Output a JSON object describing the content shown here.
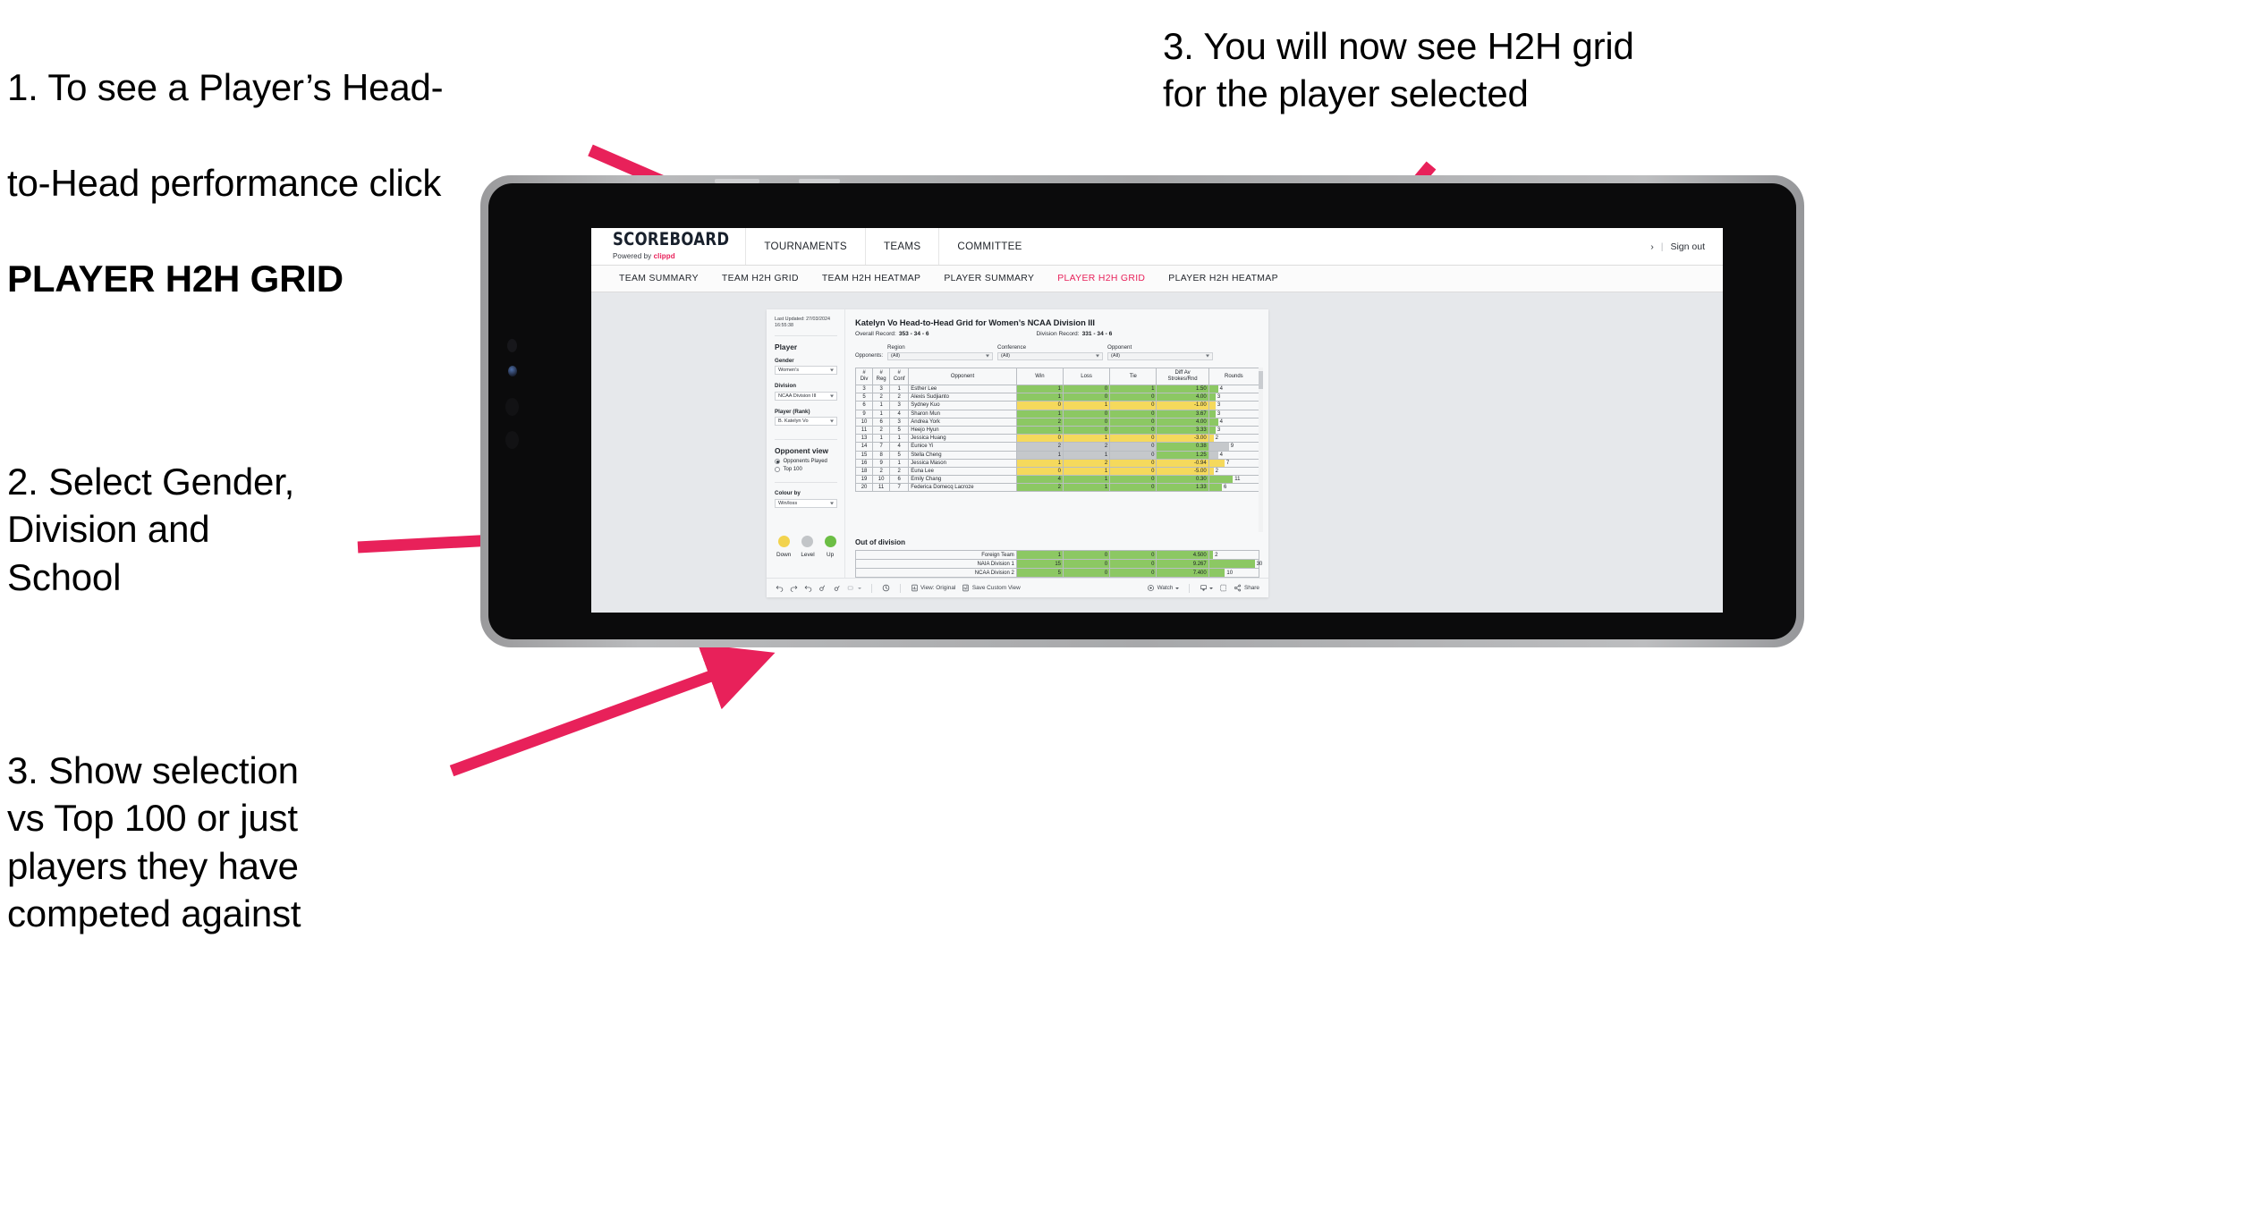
{
  "annotations": [
    {
      "id": "callout-1",
      "line1": "1. To see a Player’s Head-",
      "line2": "to-Head performance click",
      "line3": "PLAYER H2H GRID"
    },
    {
      "id": "callout-2",
      "text": "2. Select Gender,\nDivision and\nSchool"
    },
    {
      "id": "callout-3",
      "text": "3. Show selection\nvs Top 100 or just\nplayers they have\ncompeted against"
    },
    {
      "id": "callout-4",
      "text": "3. You will now see H2H grid\nfor the player selected"
    }
  ],
  "accent_pink": "#E8215A",
  "colors": {
    "up_green": "#8CC863",
    "level_grey": "#C5C8CB",
    "down_yellow": "#F5D95C"
  },
  "browser": {
    "brand": {
      "title": "SCOREBOARD",
      "sub_prefix": "Powered by ",
      "sub_brand": "clippd"
    },
    "topnav": [
      "TOURNAMENTS",
      "TEAMS",
      "COMMITTEE"
    ],
    "account": {
      "chevron": "›",
      "separator": "|",
      "signout": "Sign out"
    },
    "subnav": [
      {
        "label": "TEAM SUMMARY",
        "active": false
      },
      {
        "label": "TEAM H2H GRID",
        "active": false
      },
      {
        "label": "TEAM H2H HEATMAP",
        "active": false
      },
      {
        "label": "PLAYER SUMMARY",
        "active": false
      },
      {
        "label": "PLAYER H2H GRID",
        "active": true
      },
      {
        "label": "PLAYER H2H HEATMAP",
        "active": false
      }
    ]
  },
  "sidebar": {
    "last_updated": "Last Updated: 27/03/2024 16:55:38",
    "player_heading": "Player",
    "fields": [
      {
        "label": "Gender",
        "value": "Women's"
      },
      {
        "label": "Division",
        "value": "NCAA Division III"
      },
      {
        "label": "Player (Rank)",
        "value": "B. Katelyn Vo"
      }
    ],
    "opponent_view": {
      "heading": "Opponent view",
      "options": [
        {
          "label": "Opponents Played",
          "selected": true
        },
        {
          "label": "Top 100",
          "selected": false
        }
      ]
    },
    "colour_by": {
      "label": "Colour by",
      "value": "Win/loss"
    },
    "legend": [
      {
        "caption": "Down",
        "color": "#F2D34E"
      },
      {
        "caption": "Level",
        "color": "#C2C5C8"
      },
      {
        "caption": "Up",
        "color": "#6CBE45"
      }
    ]
  },
  "viz": {
    "title": "Katelyn Vo Head-to-Head Grid for Women’s NCAA Division III",
    "overall_label": "Overall Record:",
    "overall_value": "353 -  34 - 6",
    "division_label": "Division Record:",
    "division_value": "331 -  34 - 6",
    "opponents_label": "Opponents:",
    "filters": [
      {
        "label": "Region",
        "value": "(All)"
      },
      {
        "label": "Conference",
        "value": "(All)"
      },
      {
        "label": "Opponent",
        "value": "(All)"
      }
    ],
    "columns": [
      {
        "l1": "#",
        "l2": "Div"
      },
      {
        "l1": "#",
        "l2": "Reg"
      },
      {
        "l1": "#",
        "l2": "Conf"
      },
      {
        "l1": "",
        "l2": "Opponent"
      },
      {
        "l1": "",
        "l2": "Win"
      },
      {
        "l1": "",
        "l2": "Loss"
      },
      {
        "l1": "",
        "l2": "Tie"
      },
      {
        "l1": "Diff Av",
        "l2": "Strokes/Rnd"
      },
      {
        "l1": "",
        "l2": "Rounds"
      }
    ],
    "rows": [
      {
        "div": "3",
        "reg": "3",
        "conf": "1",
        "opponent": "Esther Lee",
        "win": "1",
        "loss": "0",
        "tie": "1",
        "diff": "1.50",
        "rounds": "4",
        "state": "up",
        "rbar": 18
      },
      {
        "div": "5",
        "reg": "2",
        "conf": "2",
        "opponent": "Alexis Sudjianto",
        "win": "1",
        "loss": "0",
        "tie": "0",
        "diff": "4.00",
        "rounds": "3",
        "state": "up",
        "rbar": 13
      },
      {
        "div": "6",
        "reg": "1",
        "conf": "3",
        "opponent": "Sydney Kuo",
        "win": "0",
        "loss": "1",
        "tie": "0",
        "diff": "-1.00",
        "rounds": "3",
        "state": "down",
        "rbar": 13
      },
      {
        "div": "9",
        "reg": "1",
        "conf": "4",
        "opponent": "Sharon Mun",
        "win": "1",
        "loss": "0",
        "tie": "0",
        "diff": "3.67",
        "rounds": "3",
        "state": "up",
        "rbar": 13
      },
      {
        "div": "10",
        "reg": "6",
        "conf": "3",
        "opponent": "Andrea York",
        "win": "2",
        "loss": "0",
        "tie": "0",
        "diff": "4.00",
        "rounds": "4",
        "state": "up",
        "rbar": 18
      },
      {
        "div": "11",
        "reg": "2",
        "conf": "5",
        "opponent": "Heejo Hyun",
        "win": "1",
        "loss": "0",
        "tie": "0",
        "diff": "3.33",
        "rounds": "3",
        "state": "up",
        "rbar": 13
      },
      {
        "div": "13",
        "reg": "1",
        "conf": "1",
        "opponent": "Jessica Huang",
        "win": "0",
        "loss": "1",
        "tie": "0",
        "diff": "-3.00",
        "rounds": "2",
        "state": "down",
        "rbar": 9
      },
      {
        "div": "14",
        "reg": "7",
        "conf": "4",
        "opponent": "Eunice Yi",
        "win": "2",
        "loss": "2",
        "tie": "0",
        "diff": "0.38",
        "rounds": "9",
        "state": "level",
        "rbar": 40,
        "diff_state": "up"
      },
      {
        "div": "15",
        "reg": "8",
        "conf": "5",
        "opponent": "Stella Cheng",
        "win": "1",
        "loss": "1",
        "tie": "0",
        "diff": "1.25",
        "rounds": "4",
        "state": "level",
        "rbar": 18,
        "diff_state": "up"
      },
      {
        "div": "16",
        "reg": "9",
        "conf": "1",
        "opponent": "Jessica Mason",
        "win": "1",
        "loss": "2",
        "tie": "0",
        "diff": "-0.94",
        "rounds": "7",
        "state": "down",
        "rbar": 31
      },
      {
        "div": "18",
        "reg": "2",
        "conf": "2",
        "opponent": "Euna Lee",
        "win": "0",
        "loss": "1",
        "tie": "0",
        "diff": "-5.00",
        "rounds": "2",
        "state": "down",
        "rbar": 9
      },
      {
        "div": "19",
        "reg": "10",
        "conf": "6",
        "opponent": "Emily Chang",
        "win": "4",
        "loss": "1",
        "tie": "0",
        "diff": "0.30",
        "rounds": "11",
        "state": "up",
        "rbar": 48
      },
      {
        "div": "20",
        "reg": "11",
        "conf": "7",
        "opponent": "Federica Domecq Lacroze",
        "win": "2",
        "loss": "1",
        "tie": "0",
        "diff": "1.33",
        "rounds": "6",
        "state": "up",
        "rbar": 26
      }
    ],
    "out_of_division": {
      "title": "Out of division",
      "rows": [
        {
          "label": "Foreign Team",
          "win": "1",
          "loss": "0",
          "tie": "0",
          "diff": "4.500",
          "rounds": "2",
          "state": "up",
          "rbar": 8
        },
        {
          "label": "NAIA Division 1",
          "win": "15",
          "loss": "0",
          "tie": "0",
          "diff": "9.267",
          "rounds": "30",
          "state": "up",
          "rbar": 92
        },
        {
          "label": "NCAA Division 2",
          "win": "5",
          "loss": "0",
          "tie": "0",
          "diff": "7.400",
          "rounds": "10",
          "state": "up",
          "rbar": 32
        }
      ]
    }
  },
  "toolbar": {
    "view_label": "View: Original",
    "save_label": "Save Custom View",
    "watch_label": "Watch",
    "share_label": "Share"
  }
}
